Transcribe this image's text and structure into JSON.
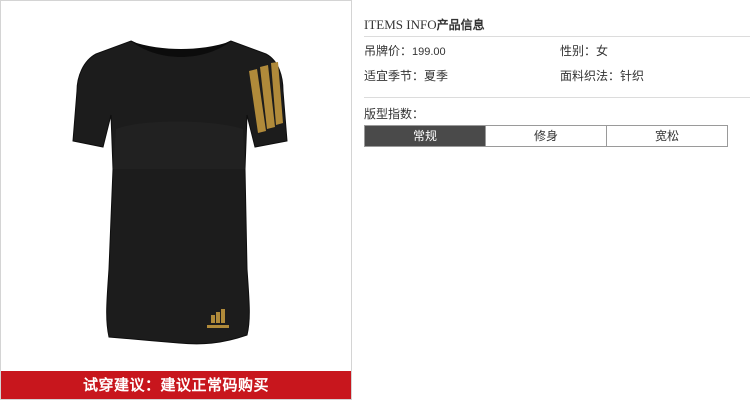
{
  "product": {
    "image_icon": "black-womens-tshirt-image",
    "fit_banner": "试穿建议：建议正常码购买",
    "banner_color": "#c8161d"
  },
  "info": {
    "title_latin": "ITEMS INFO",
    "title_cn": "产品信息",
    "price_label": "吊牌价：",
    "price_value": "199.00",
    "gender_label": "性别：",
    "gender_value": "女",
    "season_label": "适宜季节：",
    "season_value": "夏季",
    "fabric_label": "面料织法：",
    "fabric_value": "针织",
    "fit_label": "版型指数：",
    "fit_options": [
      "常规",
      "修身",
      "宽松"
    ],
    "fit_selected": "常规",
    "active_color": "#4a4a4a"
  }
}
